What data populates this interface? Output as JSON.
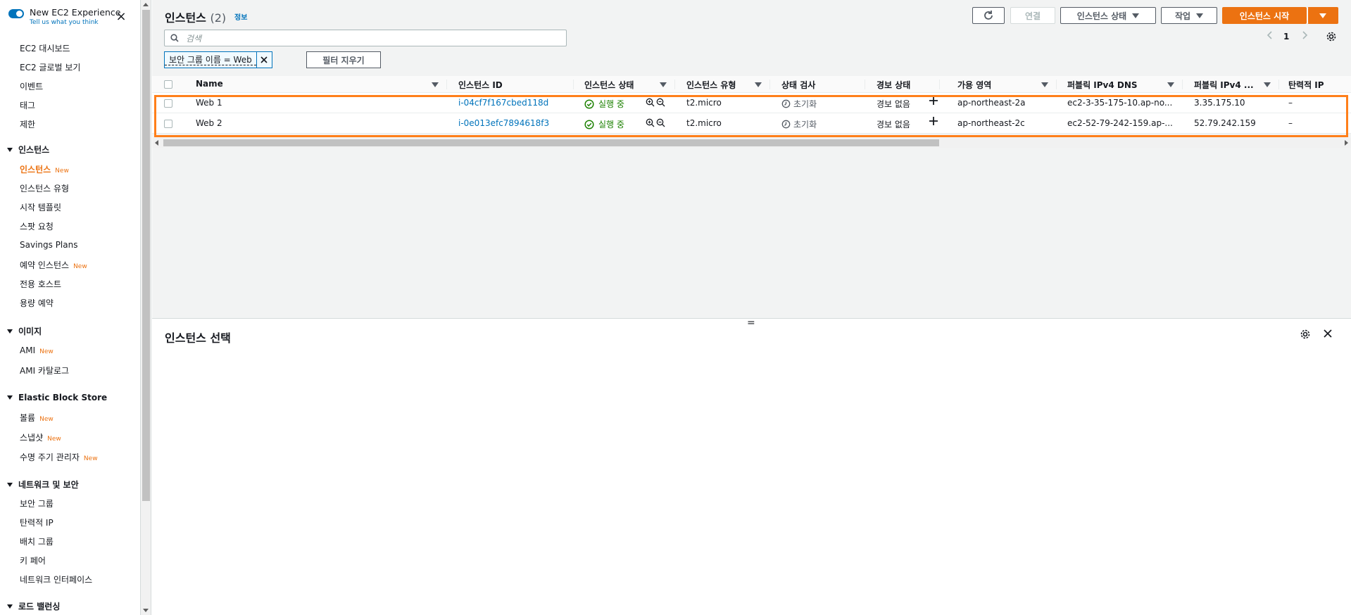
{
  "sidebar": {
    "experience_title": "New EC2 Experience",
    "experience_sub": "Tell us what you think",
    "items_top": [
      "EC2 대시보드",
      "EC2 글로벌 보기",
      "이벤트",
      "태그",
      "제한"
    ],
    "sections": {
      "instances": "인스턴스",
      "images": "이미지",
      "ebs": "Elastic Block Store",
      "network": "네트워크 및 보안",
      "lb": "로드 밸런싱"
    },
    "instances_items": [
      "인스턴스",
      "인스턴스 유형",
      "시작 템플릿",
      "스팟 요청",
      "Savings Plans",
      "예약 인스턴스",
      "전용 호스트",
      "용량 예약"
    ],
    "images_items": [
      "AMI",
      "AMI 카탈로그"
    ],
    "ebs_items": [
      "볼륨",
      "스냅샷",
      "수명 주기 관리자"
    ],
    "network_items": [
      "보안 그룹",
      "탄력적 IP",
      "배치 그룹",
      "키 페어",
      "네트워크 인터페이스"
    ],
    "new_badge": "New"
  },
  "header": {
    "title": "인스턴스",
    "count": "(2)",
    "info": "정보",
    "connect": "연결",
    "state": "인스턴스 상태",
    "actions": "작업",
    "launch": "인스턴스 시작"
  },
  "search": {
    "placeholder": "검색"
  },
  "pager": {
    "page": "1"
  },
  "filter": {
    "chip": "보안 그룹 이름 = Web",
    "clear": "필터 지우기"
  },
  "table": {
    "headers": [
      "Name",
      "인스턴스 ID",
      "인스턴스 상태",
      "인스턴스 유형",
      "상태 검사",
      "경보 상태",
      "가용 영역",
      "퍼블릭 IPv4 DNS",
      "퍼블릭 IPv4 ...",
      "탄력적 IP"
    ],
    "rows": [
      {
        "name": "Web 1",
        "id": "i-04cf7f167cbed118d",
        "state": "실행 중",
        "type": "t2.micro",
        "check": "초기화",
        "alarm": "경보 없음",
        "az": "ap-northeast-2a",
        "dns": "ec2-3-35-175-10.ap-no...",
        "ip": "3.35.175.10",
        "eip": "–"
      },
      {
        "name": "Web 2",
        "id": "i-0e013efc7894618f3",
        "state": "실행 중",
        "type": "t2.micro",
        "check": "초기화",
        "alarm": "경보 없음",
        "az": "ap-northeast-2c",
        "dns": "ec2-52-79-242-159.ap-...",
        "ip": "52.79.242.159",
        "eip": "–"
      }
    ]
  },
  "split": {
    "handle": "=",
    "title": "인스턴스 선택"
  },
  "colors": {
    "accent": "#ec7211",
    "link": "#0073bb",
    "ok": "#1d8102",
    "highlight": "#ff7f1a"
  }
}
